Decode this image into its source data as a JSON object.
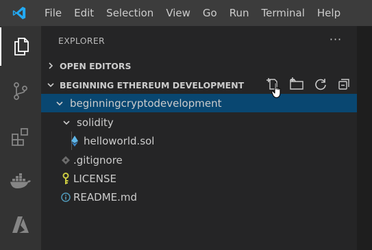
{
  "menu": [
    "File",
    "Edit",
    "Selection",
    "View",
    "Go",
    "Run",
    "Terminal",
    "Help"
  ],
  "explorer": {
    "title": "EXPLORER",
    "more": "···",
    "open_editors": "OPEN EDITORS",
    "workspace": "BEGINNING ETHEREUM DEVELOPMENT"
  },
  "tree": {
    "root": "beginningcryptodevelopment",
    "solidity": "solidity",
    "hello": "helloworld.sol",
    "gitignore": ".gitignore",
    "license": "LICENSE",
    "readme": "README.md"
  },
  "colors": {
    "titlebar": "#3c3c3c",
    "activitybar": "#333333",
    "sidebar": "#252526",
    "selection": "#094771",
    "vscode_blue": "#23a9f2"
  }
}
